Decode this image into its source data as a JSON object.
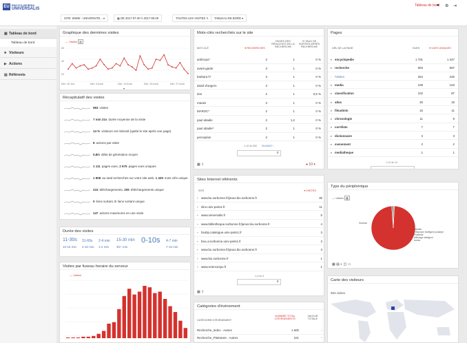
{
  "brand": {
    "line1": "ENCYCLOPÆDIA",
    "line2": "UNIVERSALIS",
    "mark": "EU"
  },
  "topbar": {
    "site": "SITE: WWW - UNIVERSITE...",
    "period": "DE 2017-07-30 À 2017-08-29",
    "segment": "TOUTES LES VISITES",
    "dashboard": "TABLEAU DE BORD",
    "dashboard_link": "Tableau de bord"
  },
  "sidebar": {
    "items": [
      {
        "label": "Tableau de bord",
        "icon": "▦"
      },
      {
        "label": "Tableau de bord"
      },
      {
        "label": "Visiteurs",
        "icon": "■"
      },
      {
        "label": "Actions",
        "icon": "▶"
      },
      {
        "label": "Référents",
        "icon": "▤"
      }
    ]
  },
  "graph": {
    "title": "Graphique des dernières visites",
    "legend": "Visites",
    "y_labels": [
      "60",
      "40",
      "20"
    ],
    "x_labels": [
      "Dim. 30 Juil.",
      "Dim. 6 Août",
      "Dim. 13 Août",
      "Dim. 20 Août",
      "Dim. 27 Août"
    ]
  },
  "chart_data": [
    {
      "type": "line",
      "title": "Graphique des dernières visites",
      "series": [
        {
          "name": "Visites",
          "values": [
            22,
            32,
            24,
            28,
            30,
            22,
            24,
            28,
            40,
            30,
            22,
            24,
            32,
            28,
            42,
            30,
            26,
            20,
            46,
            30,
            22,
            24,
            40,
            38,
            48,
            30,
            26,
            24,
            34,
            22,
            14
          ]
        }
      ],
      "ylim": [
        0,
        60
      ]
    },
    {
      "type": "bar",
      "title": "Visites par fuseau horaire du serveur",
      "series": [
        {
          "name": "Visites",
          "values": [
            1,
            1,
            1,
            2,
            2,
            3,
            6,
            10,
            20,
            22,
            40,
            58,
            68,
            60,
            64,
            72,
            70,
            62,
            64,
            54,
            44,
            36,
            24,
            14
          ]
        }
      ]
    },
    {
      "type": "pie",
      "title": "Type du périphérique",
      "categories": [
        "Bureau",
        "Tablette",
        "Téléphone intelligent (smartph",
        "Phablette",
        "Affichage intelligent",
        "Autres"
      ],
      "values": [
        98,
        1,
        1,
        0,
        0,
        0
      ],
      "colors": [
        "#d4322e",
        "#4b74c4",
        "#e0a020",
        "#3f9e46",
        "#8a2c8a",
        "#e55a5a"
      ]
    }
  ],
  "summary": {
    "title": "Récapitulatif des visites",
    "rows": [
      [
        "983",
        "visites"
      ],
      [
        "7 min 21s",
        "durée moyenne de la visite"
      ],
      [
        "14 %",
        "visiteurs ont rebondi (quitté le site après une page)"
      ],
      [
        "8",
        "actions par visite"
      ],
      [
        "0,8/s",
        "délai de génération moyen"
      ],
      [
        "1 111",
        "pages vues, ",
        "2 675",
        "pages vues uniques"
      ],
      [
        "1 808",
        "au total recherches sur votre site web, ",
        "1 429",
        "mots clés unique"
      ],
      [
        "215",
        "téléchargements, ",
        "205",
        "téléchargements unique"
      ],
      [
        "0",
        "liens sortant, ",
        "0",
        "liens sortant unique"
      ],
      [
        "147",
        "actions maximums en une visite"
      ]
    ]
  },
  "duration": {
    "title": "Durée des visites",
    "words": [
      "11-30s",
      "31-60s",
      "2-4 min",
      "15-30 min",
      "0-10s",
      "4-7 min",
      "10-15 min",
      "4-10 min",
      "1-2 min",
      "30+ min",
      "7-10 min"
    ]
  },
  "hours": {
    "title": "Visites par fuseau horaire du serveur",
    "legend": "Visites"
  },
  "keywords": {
    "title": "Mots-clés recherchés sur le site",
    "headers": [
      "MOT-CLÉ",
      "RECHERCHES",
      "PAGES DES RÉSULTATS DE LA RECHERCHE",
      "% TAUX DE SORTIES APRÈS RECHERCHE"
    ],
    "rows": [
      [
        "anthropo*",
        "2",
        "1",
        "0 %"
      ],
      [
        "avant-garde",
        "3",
        "1",
        "0 %"
      ],
      [
        "barbara h*",
        "3",
        "1",
        "0 %"
      ],
      [
        "david d'angers",
        "3",
        "1",
        "0 %"
      ],
      [
        "dos",
        "2",
        "1",
        "0,5 %"
      ],
      [
        "marais",
        "3",
        "1",
        "0 %"
      ],
      [
        "MAROC*",
        "2",
        "1",
        "0 %"
      ],
      [
        "paul abadie",
        "2",
        "1,2",
        "0 %"
      ],
      [
        "paul abadie*",
        "2",
        "1",
        "0 %"
      ],
      [
        "perception",
        "2",
        "1",
        "0 %"
      ]
    ],
    "pager": "1-10 de 830",
    "next": "SUIVANT ›",
    "limit": "10"
  },
  "pages": {
    "title": "Pages",
    "headers": [
      "URL DE LA PAGE",
      "VUES",
      "VUES UNIQUES"
    ],
    "rows": [
      [
        "encyclopedie",
        "1 701",
        "1 347"
      ],
      [
        "recherche",
        "803",
        "687"
      ],
      [
        "/Visites",
        "264",
        "226"
      ],
      [
        "media",
        "109",
        "103"
      ],
      [
        "classification",
        "102",
        "87"
      ],
      [
        "atlas",
        "25",
        "18"
      ],
      [
        "filsudmin",
        "16",
        "11"
      ],
      [
        "chronologie",
        "11",
        "9"
      ],
      [
        "corrélats",
        "7",
        "7"
      ],
      [
        "dictionnaire",
        "3",
        "3"
      ],
      [
        "evenement",
        "2",
        "2"
      ],
      [
        "mediatheque",
        "1",
        "1"
      ]
    ],
    "pager": "1-12 de 12"
  },
  "referrers": {
    "title": "Sites Internet référents",
    "headers": [
      "SITE",
      "VISITES"
    ],
    "rows": [
      [
        "www.bu.sorbonne.fr/janus.biu.sorbonne.fr",
        "35"
      ],
      [
        "dice.univ-paris1.fr",
        "11"
      ],
      [
        "www.universalis.fr",
        "5"
      ],
      [
        "www.bibliotheque.sorbonne.fr/janus.biu.sorbonne.fr",
        "4"
      ],
      [
        "bsubp.catalogue.univ-paris1.fr",
        "3"
      ],
      [
        "bsu.ui.sorbonne.univ-paris1.fr",
        "3"
      ],
      [
        "www.bu.sorbonne.fr/janus.biu.sorbonne.fr",
        "3"
      ],
      [
        "www.biu.sorbonne.fr",
        "1"
      ],
      [
        "www.sciencespo.fr",
        "1"
      ]
    ],
    "pager": "1-9 de 9"
  },
  "device": {
    "title": "Type du périphérique",
    "legend": "Visites",
    "labels": [
      "Bureau",
      "Tablette",
      "Téléphone intelligent (smartph",
      "Phablette",
      "Affichage intelligent",
      "Autres"
    ]
  },
  "events": {
    "title": "Catégories d'évènement",
    "headers": [
      "CATÉGORIE D'ÉVÈNEMENT",
      "NOMBRE TOTAL D'ÉVÈNEMENTS",
      "VALEUR TOTALE"
    ],
    "rows": [
      [
        "Recherche_Index - Autres",
        "1 600",
        "-"
      ],
      [
        "Recherche_Plaintexte - Autres",
        "221",
        "-"
      ]
    ]
  },
  "map": {
    "title": "Carte des visiteurs",
    "count": "983 visites"
  }
}
